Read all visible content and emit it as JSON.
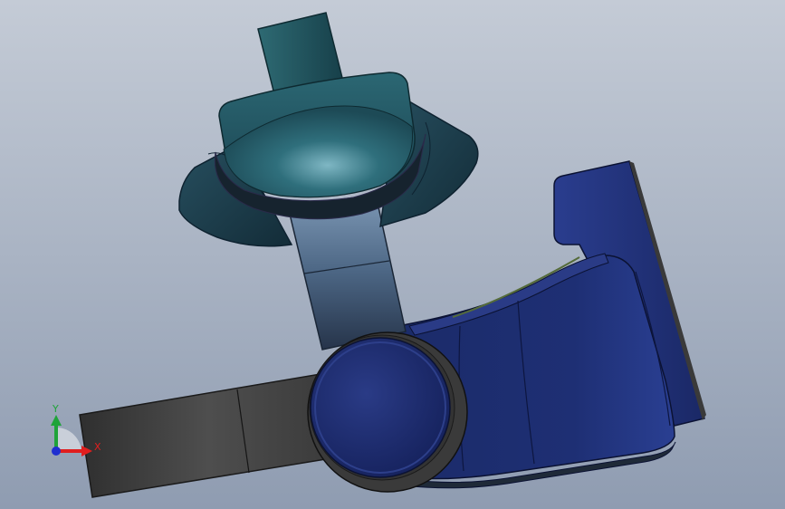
{
  "viewport": {
    "background_top": "#c4cbd6",
    "background_bottom": "#8f9cb1"
  },
  "model": {
    "colors": {
      "teal_body": "#1f4b58",
      "teal_dark": "#16323d",
      "teal_light": "#3e7f87",
      "strap_light": "#6f8aa6",
      "strap_dark": "#2f3f55",
      "blue_body": "#1c2c6b",
      "blue_dark": "#111c47",
      "blue_light": "#33479b",
      "arm_grey": "#4a4a4a",
      "arm_dark": "#2c2c2c",
      "hub_ring": "#3a3a3a"
    }
  },
  "triad": {
    "x_label": "X",
    "y_label": "Y",
    "x_color": "#e01e1e",
    "y_color": "#1fa33a",
    "z_color": "#1f2fd0"
  }
}
